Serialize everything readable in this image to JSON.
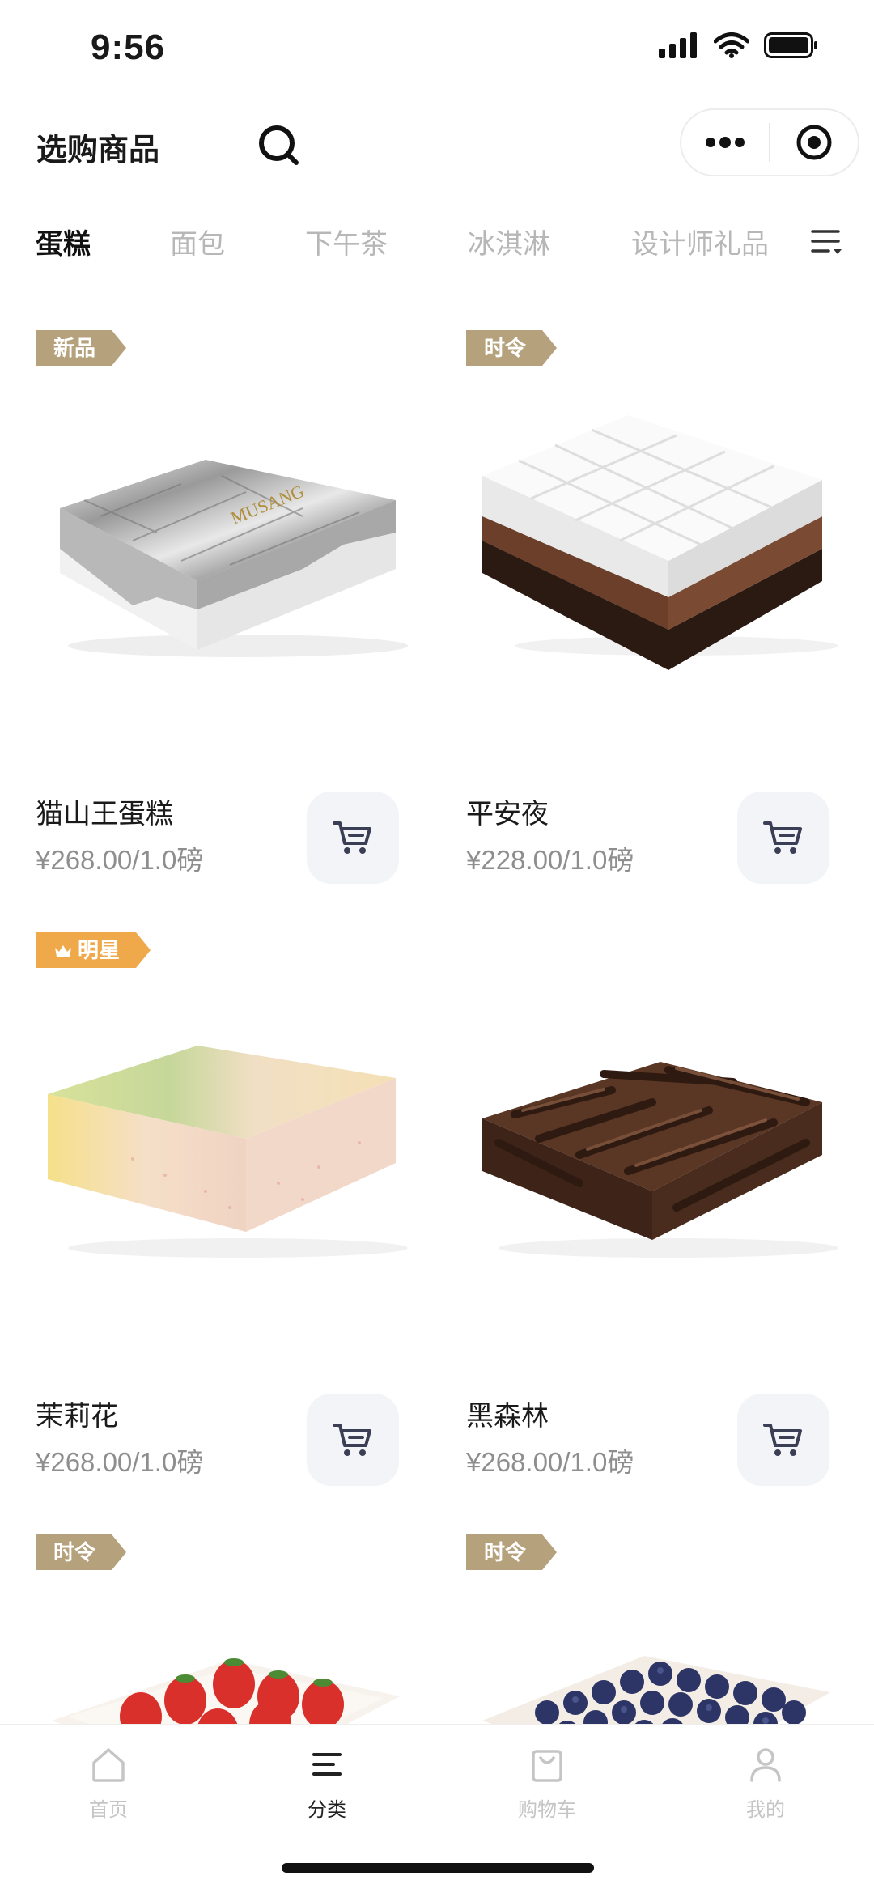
{
  "status_bar": {
    "time": "9:56"
  },
  "header": {
    "title": "选购商品"
  },
  "tabs": [
    {
      "label": "蛋糕",
      "active": true
    },
    {
      "label": "面包",
      "active": false
    },
    {
      "label": "下午茶",
      "active": false
    },
    {
      "label": "冰淇淋",
      "active": false
    },
    {
      "label": "设计师礼品",
      "active": false
    }
  ],
  "products": [
    {
      "badge": "新品",
      "badge_color": "#b5a27c",
      "name": "猫山王蛋糕",
      "price": "¥268.00/1.0磅",
      "image_icon": "foil-wrapped-cake-image"
    },
    {
      "badge": "时令",
      "badge_color": "#b5a27c",
      "name": "平安夜",
      "price": "¥228.00/1.0磅",
      "image_icon": "white-chocolate-cube-cake-image"
    },
    {
      "badge": "明星",
      "badge_color": "#f0a94a",
      "name": "茉莉花",
      "price": "¥268.00/1.0磅",
      "image_icon": "jasmine-sponge-cake-image"
    },
    {
      "badge": "",
      "name": "黑森林",
      "price": "¥268.00/1.0磅",
      "image_icon": "black-forest-cake-image"
    },
    {
      "badge": "时令",
      "badge_color": "#b5a27c",
      "name": "",
      "price": "",
      "image_icon": "strawberry-cake-image"
    },
    {
      "badge": "时令",
      "badge_color": "#b5a27c",
      "name": "",
      "price": "",
      "image_icon": "blueberry-cake-image"
    }
  ],
  "bottom_nav": [
    {
      "label": "首页",
      "icon": "home-icon",
      "active": false
    },
    {
      "label": "分类",
      "icon": "category-icon",
      "active": true
    },
    {
      "label": "购物车",
      "icon": "shopping-bag-icon",
      "active": false
    },
    {
      "label": "我的",
      "icon": "user-icon",
      "active": false
    }
  ],
  "colors": {
    "accent_tan": "#b5a27c",
    "accent_orange": "#f0a94a",
    "inactive_text": "#b7b7b7",
    "price_text": "#8e8e8e"
  }
}
